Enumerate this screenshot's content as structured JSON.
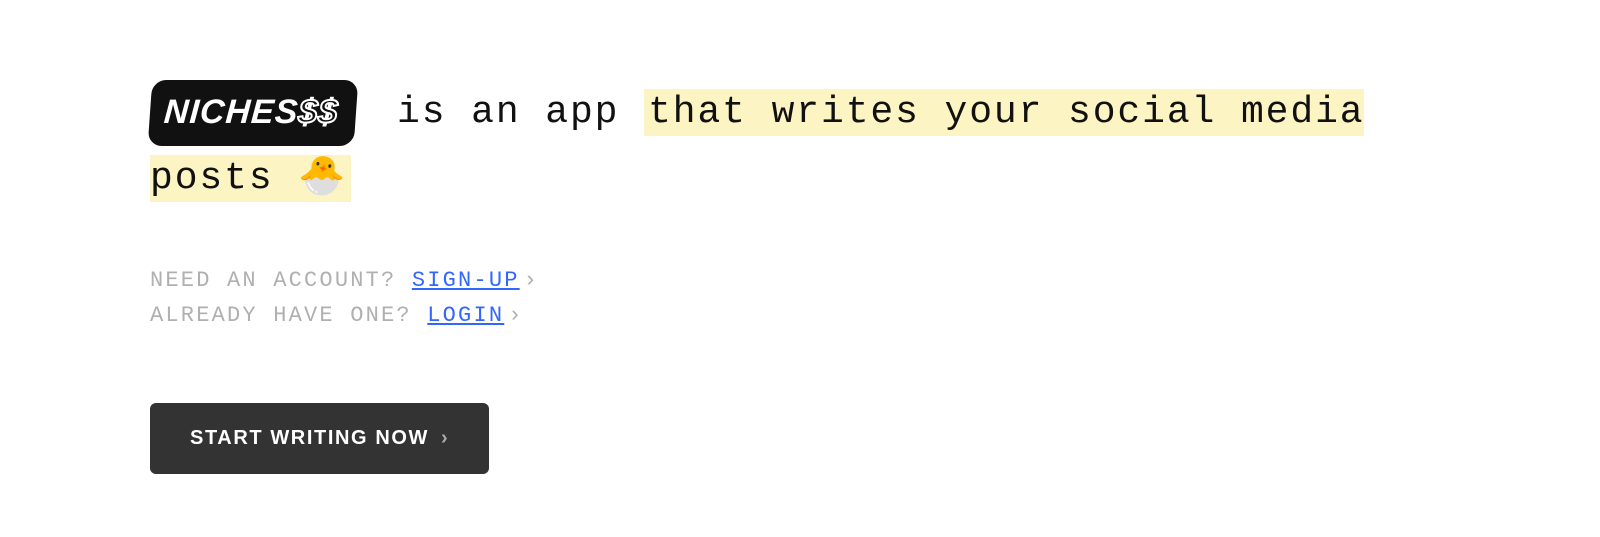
{
  "logo": {
    "text_main": "NICHES",
    "text_suffix": "$$"
  },
  "headline": {
    "plain": " is an app ",
    "highlighted": "that writes your social media posts 🐣"
  },
  "account": {
    "need_prefix": "NEED AN ACCOUNT? ",
    "signup_label": "SIGN-UP",
    "have_prefix": "ALREADY HAVE ONE? ",
    "login_label": "LOGIN",
    "chevron": "›"
  },
  "cta": {
    "label": "START WRITING NOW",
    "chevron": "›"
  }
}
